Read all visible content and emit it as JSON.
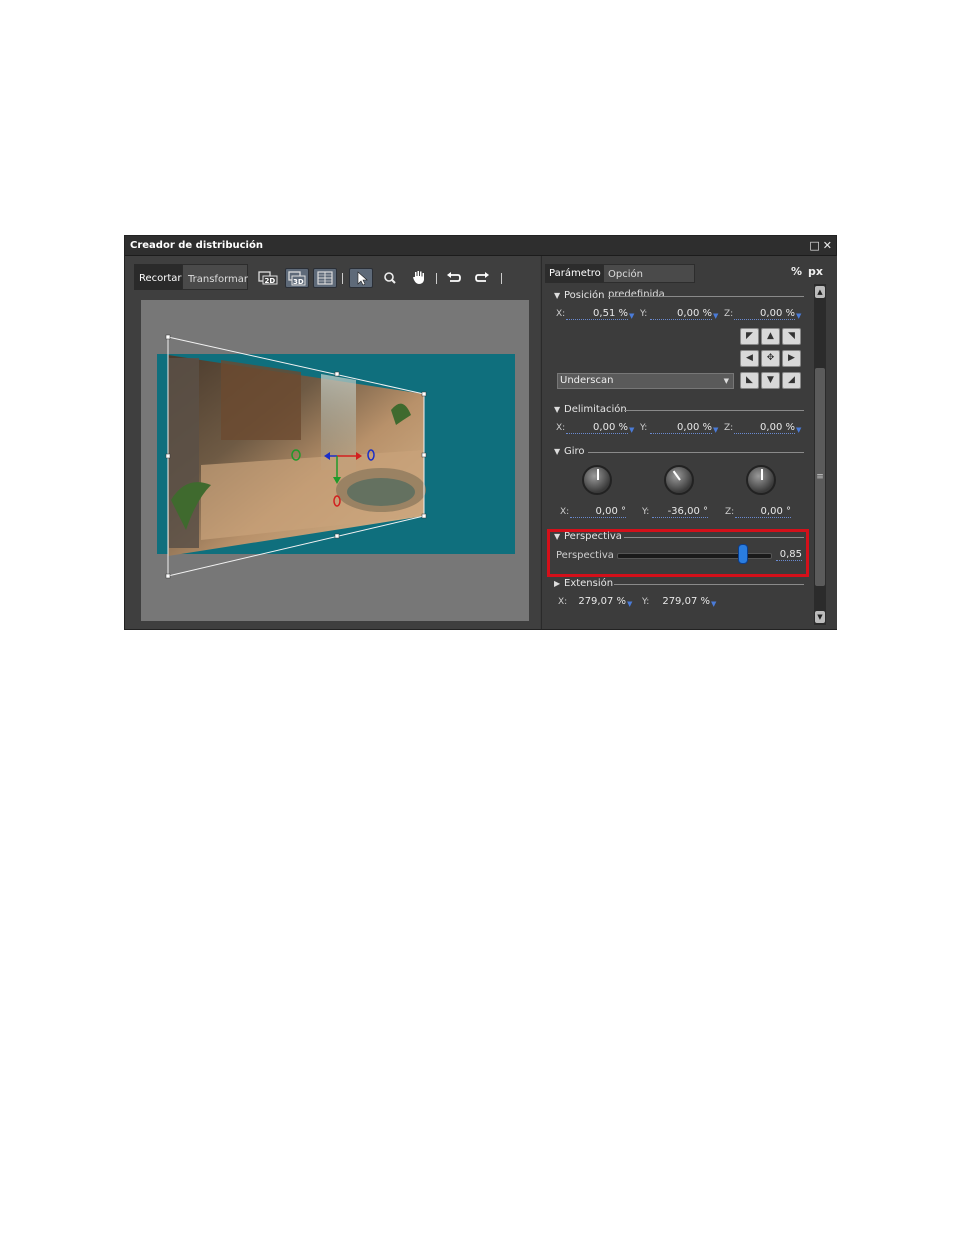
{
  "window": {
    "title": "Creador de distribución",
    "maximize_icon": "maximize-icon",
    "close_icon": "close-icon"
  },
  "left_tabs": [
    "Recortar",
    "Transformar"
  ],
  "toolbar": {
    "btn_2d": "2D",
    "btn_3d": "3D",
    "grid_icon": "grid-icon",
    "select_icon": "arrow-cursor-icon",
    "zoom_icon": "magnifier-icon",
    "hand_icon": "hand-icon",
    "undo_icon": "undo-icon",
    "redo_icon": "redo-icon"
  },
  "right_tabs": [
    "Parámetro",
    "Opción predefinida"
  ],
  "units": [
    "%",
    "px"
  ],
  "sections": {
    "posicion": {
      "title": "Posición",
      "x_label": "X:",
      "x_value": "0,51 %",
      "y_label": "Y:",
      "y_value": "0,00 %",
      "z_label": "Z:",
      "z_value": "0,00 %"
    },
    "combo": {
      "value": "Underscan"
    },
    "delimitacion": {
      "title": "Delimitación",
      "x_label": "X:",
      "x_value": "0,00 %",
      "y_label": "Y:",
      "y_value": "0,00 %",
      "z_label": "Z:",
      "z_value": "0,00 %"
    },
    "giro": {
      "title": "Giro",
      "x_label": "X:",
      "x_value": "0,00 °",
      "y_label": "Y:",
      "y_value": "-36,00 °",
      "z_label": "Z:",
      "z_value": "0,00 °"
    },
    "perspectiva": {
      "title": "Perspectiva",
      "label": "Perspectiva",
      "value": "0,85",
      "level": 0.85
    },
    "extension": {
      "title": "Extensión",
      "x_label": "X:",
      "x_value": "279,07 %",
      "y_label": "Y:",
      "y_value": "279,07 %"
    }
  },
  "colors": {
    "teal_background": "#0f6f7d",
    "canvas_gray": "#777777",
    "highlight": "#d4101a",
    "slider_thumb": "#2a7de0"
  }
}
